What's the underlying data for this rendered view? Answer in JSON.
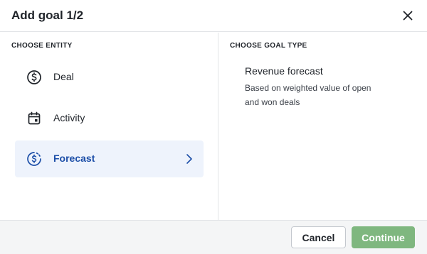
{
  "dialog": {
    "title": "Add goal 1/2",
    "close_icon": "close-icon"
  },
  "left": {
    "section_label": "CHOOSE ENTITY",
    "items": [
      {
        "label": "Deal",
        "icon": "dollar-circle-icon",
        "selected": false
      },
      {
        "label": "Activity",
        "icon": "calendar-icon",
        "selected": false
      },
      {
        "label": "Forecast",
        "icon": "forecast-dollar-icon",
        "selected": true,
        "trailing_icon": "chevron-right-icon"
      }
    ]
  },
  "right": {
    "section_label": "CHOOSE GOAL TYPE",
    "goal_types": [
      {
        "title": "Revenue forecast",
        "description": "Based on weighted value of open and won deals"
      }
    ]
  },
  "footer": {
    "cancel_label": "Cancel",
    "continue_label": "Continue"
  },
  "colors": {
    "selected_bg": "#eef3fc",
    "selected_text": "#1d4fa8",
    "continue_bg": "#7fb77f"
  }
}
